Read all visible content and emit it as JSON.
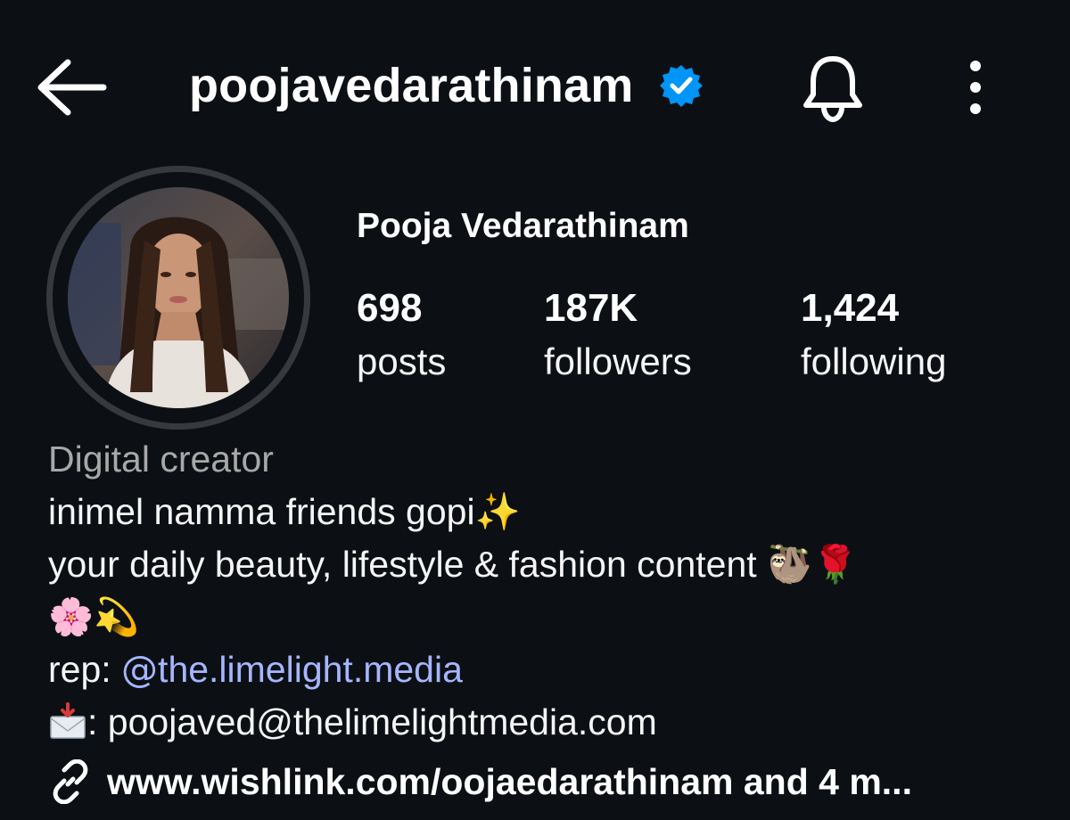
{
  "header": {
    "username": "poojavedarathinam",
    "icons": {
      "back": "arrow-left-icon",
      "verified": "verified-badge-icon",
      "notifications": "bell-icon",
      "more": "more-vertical-icon"
    },
    "colors": {
      "background": "#0c1014",
      "verified_blue": "#0095f6",
      "link_purple": "#a6b6ff",
      "secondary_text": "#a8a8a8"
    }
  },
  "profile": {
    "full_name": "Pooja Vedarathinam",
    "stats": {
      "posts_count": "698",
      "posts_label": "posts",
      "followers_count": "187K",
      "followers_label": "followers",
      "following_count": "1,424",
      "following_label": "following"
    }
  },
  "bio": {
    "category": "Digital creator",
    "line1": "inimel namma friends gopi✨",
    "line2": "your daily beauty, lifestyle & fashion content 🦥🌹",
    "line3": "🌸💫",
    "rep_prefix": "rep: ",
    "rep_threads_glyph": "@",
    "rep_handle": "the.limelight.media",
    "email_prefix": ": ",
    "email": "poojaved@thelimelightmedia.com",
    "link_text": "www.wishlink.com/oojaedarathinam and 4 m..."
  }
}
